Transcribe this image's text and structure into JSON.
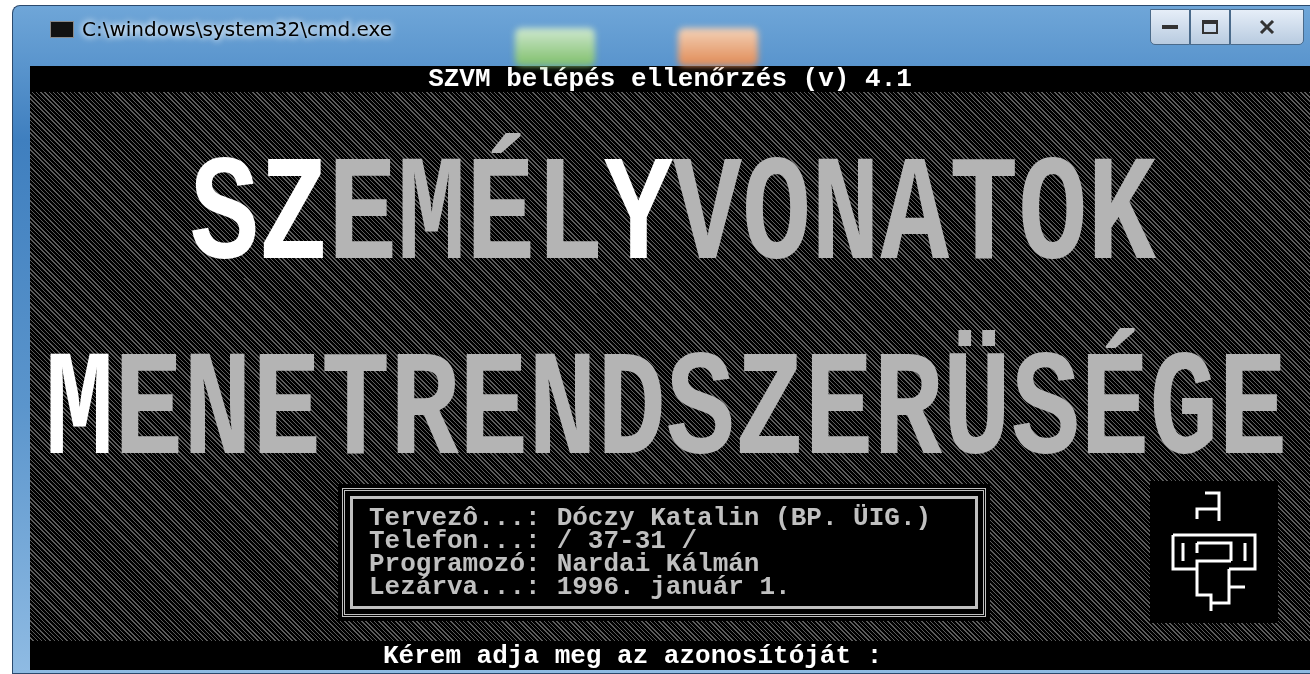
{
  "window": {
    "title": "C:\\windows\\system32\\cmd.exe"
  },
  "console": {
    "header": "SZVM belépés ellenőrzés (v) 4.1",
    "banner": [
      {
        "segments": [
          {
            "text": "SZ",
            "bright": true
          },
          {
            "text": "EMÉL",
            "bright": false
          },
          {
            "text": "Y",
            "bright": true
          },
          {
            "text": "VONATOK",
            "bright": false
          }
        ]
      },
      {
        "segments": [
          {
            "text": "M",
            "bright": true
          },
          {
            "text": "ENETRENDSZERÜSÉGE",
            "bright": false
          }
        ]
      }
    ],
    "info": [
      {
        "label": "Tervezô...:",
        "value": "Dóczy Katalin (BP. ÜIG.)"
      },
      {
        "label": "Telefon...:",
        "value": "/ 37-31 /"
      },
      {
        "label": "Programozó:",
        "value": "Nardai Kálmán"
      },
      {
        "label": "Lezárva...:",
        "value": "1996. január 1."
      }
    ],
    "prompt": "Kérem adja meg az azonosítóját :"
  }
}
